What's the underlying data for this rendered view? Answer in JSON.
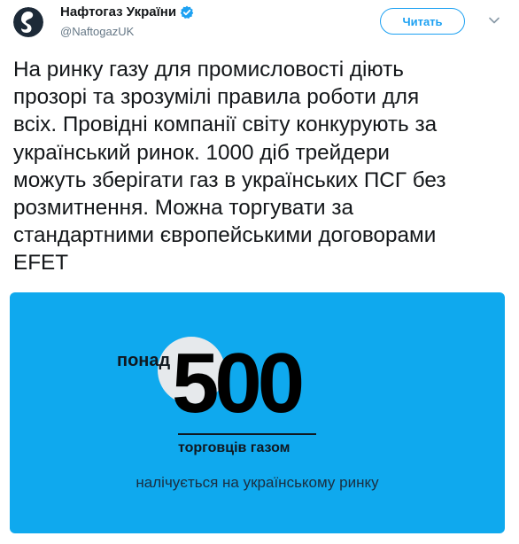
{
  "account": {
    "display_name": "Нафтогаз України",
    "handle": "@NaftogazUK",
    "verified": true,
    "avatar_icon": "naftogaz-logo-icon"
  },
  "follow_button": {
    "label": "Читать"
  },
  "tweet": {
    "text": "На ринку газу для промисловості діють\nпрозорі та зрозумілі правила роботи для\nвсіх. Провідні компанії світу конкурують за\nукраїнський ринок. 1000 діб трейдери\nможуть зберігати газ в українських ПСГ без\nрозмитнення. Можна торгувати за\nстандартними європейськими договорами\nEFET"
  },
  "card": {
    "prefix": "понад",
    "number": "500",
    "label": "торговців газом",
    "caption": "налічується на українському ринку",
    "background_color": "#0fa9ee"
  },
  "colors": {
    "accent": "#1da1f2",
    "text": "#14171a",
    "muted": "#657786"
  }
}
